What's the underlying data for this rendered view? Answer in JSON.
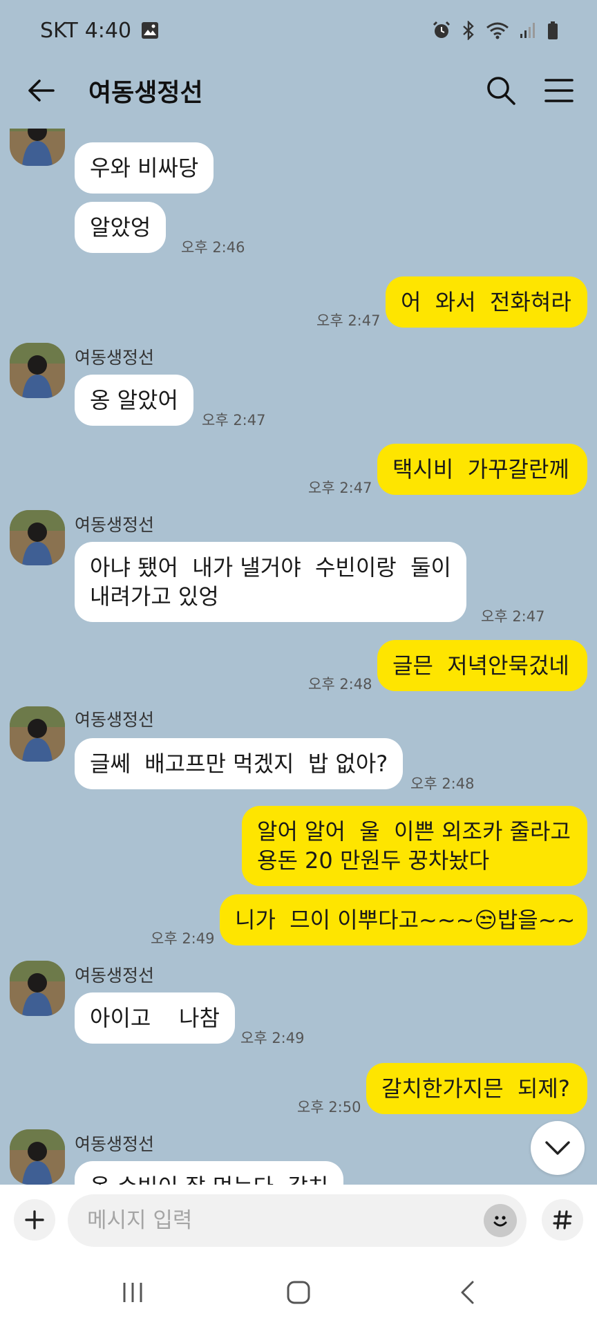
{
  "status_bar": {
    "carrier": "SKT",
    "time": "4:40"
  },
  "header": {
    "title": "여동생정선"
  },
  "messages": [
    {
      "text": "우와 비싸당"
    },
    {
      "text": "알았엉",
      "time": "오후 2:46"
    },
    {
      "text": "어  와서  전화혀라",
      "time": "오후 2:47"
    },
    {
      "sender": "여동생정선",
      "text": "옹 알았어",
      "time": "오후 2:47"
    },
    {
      "text": "택시비  가꾸갈란께",
      "time": "오후 2:47"
    },
    {
      "sender": "여동생정선",
      "text": "아냐 됐어  내가 낼거야  수빈이랑  둘이\n내려가고 있엉",
      "time": "오후 2:47"
    },
    {
      "text": "글믄  저녁안묵겄네",
      "time": "오후 2:48"
    },
    {
      "sender": "여동생정선",
      "text": "글쎄  배고프만 먹겠지  밥 없아?",
      "time": "오후 2:48"
    },
    {
      "text": "알어 알어  울  이쁜 외조카 줄라고\n용돈 20 만원두 꿍차놨다"
    },
    {
      "text": "니가  므이 이뿌다고~~~😒밥을~~",
      "time": "오후 2:49"
    },
    {
      "sender": "여동생정선",
      "text": "아이고    나참",
      "time": "오후 2:49"
    },
    {
      "text": "갈치한가지믄  되제?",
      "time": "오후 2:50"
    },
    {
      "sender": "여동생정선",
      "text": "옹 수빈이 잘 먹는다  갈치"
    }
  ],
  "input": {
    "placeholder": "메시지 입력"
  },
  "icons": {
    "back": "back-arrow-icon",
    "search": "search-icon",
    "menu": "menu-icon",
    "plus": "plus-icon",
    "emoji": "emoji-icon",
    "hash": "hash-icon",
    "scroll_down": "chevron-down-icon"
  },
  "colors": {
    "background": "#abc1d1",
    "my_bubble": "#fee500",
    "their_bubble": "#ffffff"
  }
}
